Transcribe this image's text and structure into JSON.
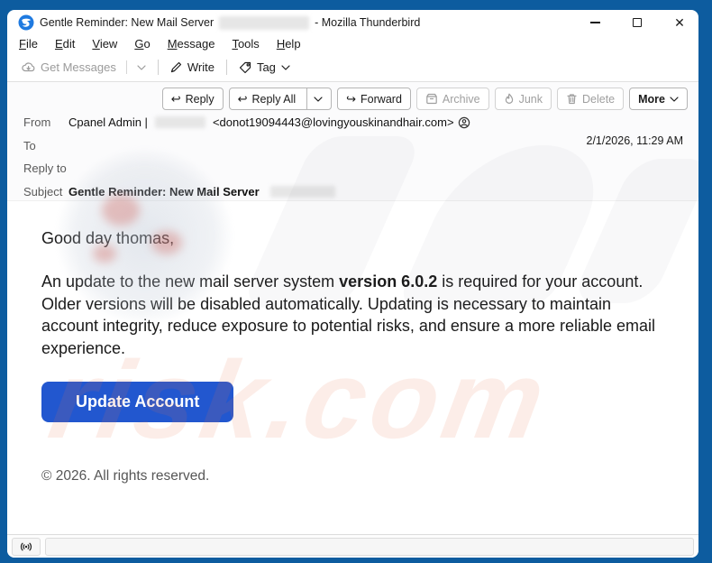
{
  "window": {
    "title": "Gentle Reminder: New Mail Server",
    "title_suffix": "- Mozilla Thunderbird"
  },
  "menu": {
    "items": [
      {
        "label": "File"
      },
      {
        "label": "Edit"
      },
      {
        "label": "View"
      },
      {
        "label": "Go"
      },
      {
        "label": "Message"
      },
      {
        "label": "Tools"
      },
      {
        "label": "Help"
      }
    ]
  },
  "toolbar": {
    "get_messages_label": "Get Messages",
    "write_label": "Write",
    "tag_label": "Tag"
  },
  "actions": {
    "reply": "Reply",
    "reply_all": "Reply All",
    "forward": "Forward",
    "archive": "Archive",
    "junk": "Junk",
    "delete": "Delete",
    "more": "More"
  },
  "headers": {
    "from_label": "From",
    "from_name": "Cpanel Admin |",
    "from_email": "<donot19094443@lovingyouskinandhair.com>",
    "to_label": "To",
    "reply_to_label": "Reply to",
    "subject_label": "Subject",
    "subject_value": "Gentle Reminder: New Mail Server",
    "date": "2/1/2026, 11:29 AM"
  },
  "message": {
    "greeting": "Good day thomas,",
    "body_pre": "An update to the new mail server system ",
    "body_bold": "version 6.0.2",
    "body_post": " is required for your account. Older versions will be disabled automatically. Updating is necessary to maintain account integrity, reduce exposure to potential risks, and ensure a more reliable email experience.",
    "button_label": "Update Account",
    "footer": "© 2026. All rights reserved."
  },
  "watermark": {
    "text": "risk.com"
  },
  "colors": {
    "frame_blue": "#0d5c9f",
    "button_blue": "#2257cf",
    "disabled_gray": "#9b9b9b"
  },
  "reply_arrow_glyph": "↩",
  "forward_arrow_glyph": "↪"
}
